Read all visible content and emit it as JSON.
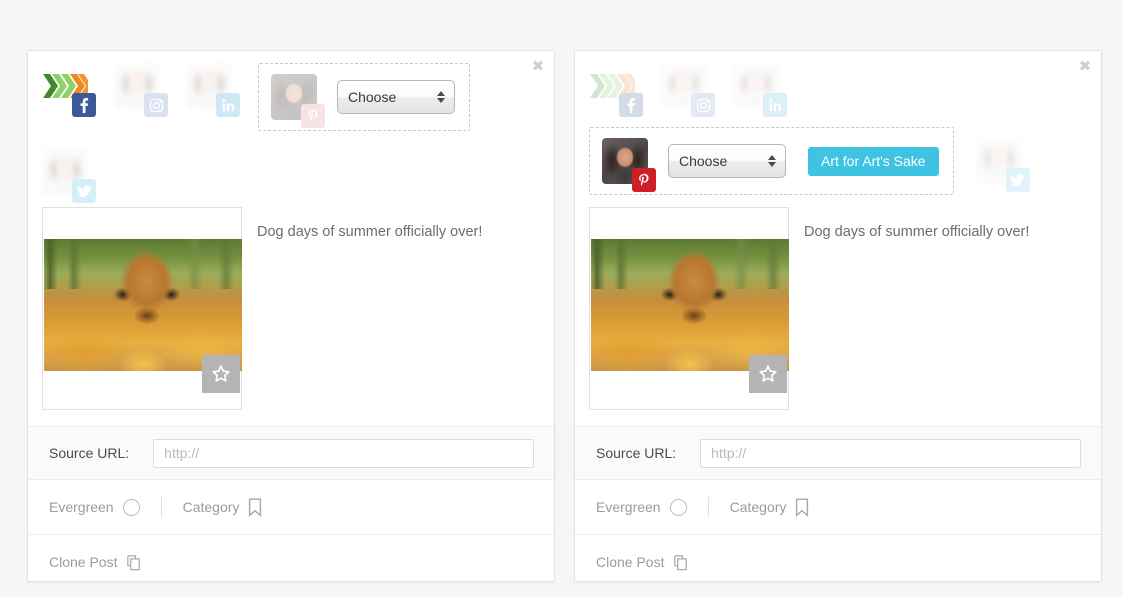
{
  "panels": [
    {
      "id": "left",
      "close_label": "✖",
      "accounts_top": [
        {
          "network": "facebook",
          "icon": "facebook-icon",
          "avatar": "brand-logo",
          "faded": false
        },
        {
          "network": "instagram",
          "icon": "instagram-icon",
          "avatar": "portrait",
          "faded": true
        },
        {
          "network": "linkedin",
          "icon": "linkedin-icon",
          "avatar": "portrait",
          "faded": true
        }
      ],
      "pinterest_group": {
        "network": "pinterest",
        "icon": "pinterest-icon",
        "avatar": "portrait",
        "faded": true,
        "select_value": "Choose",
        "board_button": null
      },
      "accounts_bottom": [
        {
          "network": "twitter",
          "icon": "twitter-icon",
          "avatar": "portrait",
          "faded": true
        }
      ],
      "post_text": "Dog days of summer officially over!",
      "thumb": {
        "star_icon": "star-icon",
        "alt": "dog lying in autumn leaves"
      },
      "source": {
        "label": "Source URL:",
        "value": "",
        "placeholder": "http://"
      },
      "options": {
        "evergreen_label": "Evergreen",
        "evergreen_icon": "circle-icon",
        "category_label": "Category",
        "category_icon": "bookmark-icon"
      },
      "clone": {
        "label": "Clone Post",
        "icon": "copy-icon"
      }
    },
    {
      "id": "right",
      "close_label": "✖",
      "accounts_top": [
        {
          "network": "facebook",
          "icon": "facebook-icon",
          "avatar": "brand-logo",
          "faded": true
        },
        {
          "network": "instagram",
          "icon": "instagram-icon",
          "avatar": "portrait",
          "faded": true
        },
        {
          "network": "linkedin",
          "icon": "linkedin-icon",
          "avatar": "portrait",
          "faded": true
        }
      ],
      "pinterest_group": {
        "network": "pinterest",
        "icon": "pinterest-icon",
        "avatar": "portrait",
        "faded": false,
        "select_value": "Choose",
        "board_button": "Art for Art's Sake"
      },
      "accounts_bottom": [
        {
          "network": "twitter",
          "icon": "twitter-icon",
          "avatar": "portrait",
          "faded": true
        }
      ],
      "post_text": "Dog days of summer officially over!",
      "thumb": {
        "star_icon": "star-icon",
        "alt": "dog lying in autumn leaves"
      },
      "source": {
        "label": "Source URL:",
        "value": "",
        "placeholder": "http://"
      },
      "options": {
        "evergreen_label": "Evergreen",
        "evergreen_icon": "circle-icon",
        "category_label": "Category",
        "category_icon": "bookmark-icon"
      },
      "clone": {
        "label": "Clone Post",
        "icon": "copy-icon"
      }
    }
  ],
  "colors": {
    "page_bg": "#f6f6f6",
    "panel_bg": "#ffffff",
    "accent_button": "#3fc3e3",
    "facebook": "#3b5998",
    "instagram": "#8a9dd4",
    "linkedin": "#5fb9e0",
    "twitter": "#74cdf0",
    "pinterest": "#cd1f28",
    "muted_text": "#9b9b9b",
    "body_text": "#6d6d6d"
  }
}
